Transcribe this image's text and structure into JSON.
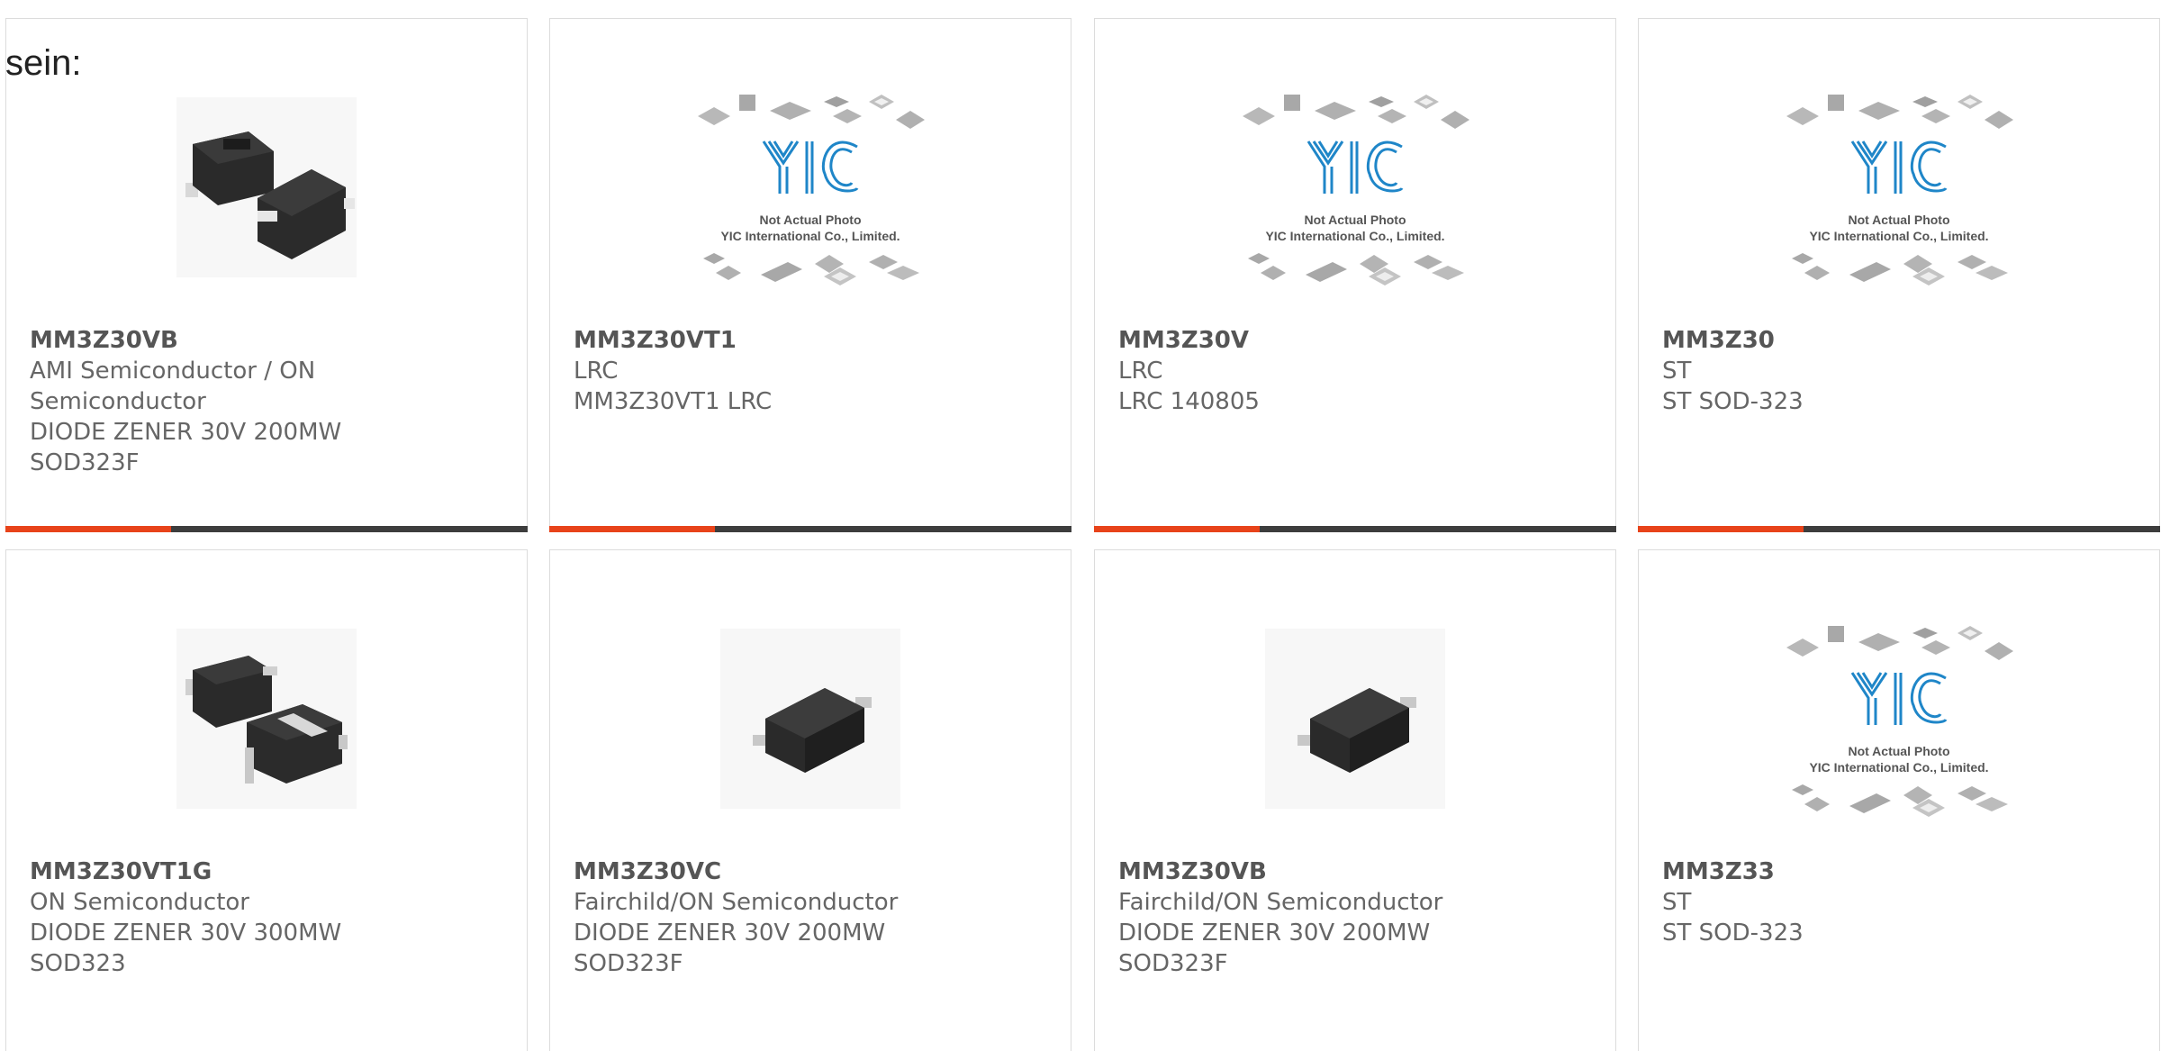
{
  "intro_text": "sein:",
  "placeholder_image": {
    "line1": "Not Actual Photo",
    "line2": "YIC International Co., Limited.",
    "logo": "YIC"
  },
  "colors": {
    "accent": "#e8431a",
    "bar": "#3d3d3d",
    "logo": "#1f86c8"
  },
  "products": [
    {
      "part": "MM3Z30VB",
      "lines": [
        "AMI Semiconductor / ON",
        "Semiconductor",
        "DIODE ZENER 30V 200MW",
        "SOD323F"
      ],
      "image": "package-sod323f-two-icon"
    },
    {
      "part": "MM3Z30VT1",
      "lines": [
        "LRC",
        "MM3Z30VT1 LRC"
      ],
      "image": "yic-placeholder"
    },
    {
      "part": "MM3Z30V",
      "lines": [
        "LRC",
        "LRC 140805"
      ],
      "image": "yic-placeholder"
    },
    {
      "part": "MM3Z30",
      "lines": [
        "ST",
        "ST SOD-323"
      ],
      "image": "yic-placeholder"
    },
    {
      "part": "MM3Z30VT1G",
      "lines": [
        "ON Semiconductor",
        "DIODE ZENER 30V 300MW",
        "SOD323"
      ],
      "image": "package-sod323-two-icon"
    },
    {
      "part": "MM3Z30VC",
      "lines": [
        "Fairchild/ON Semiconductor",
        "DIODE ZENER 30V 200MW",
        "SOD323F"
      ],
      "image": "package-sod323f-single-icon"
    },
    {
      "part": "MM3Z30VB",
      "lines": [
        "Fairchild/ON Semiconductor",
        "DIODE ZENER 30V 200MW",
        "SOD323F"
      ],
      "image": "package-sod323f-single-icon"
    },
    {
      "part": "MM3Z33",
      "lines": [
        "ST",
        "ST SOD-323"
      ],
      "image": "yic-placeholder"
    }
  ]
}
